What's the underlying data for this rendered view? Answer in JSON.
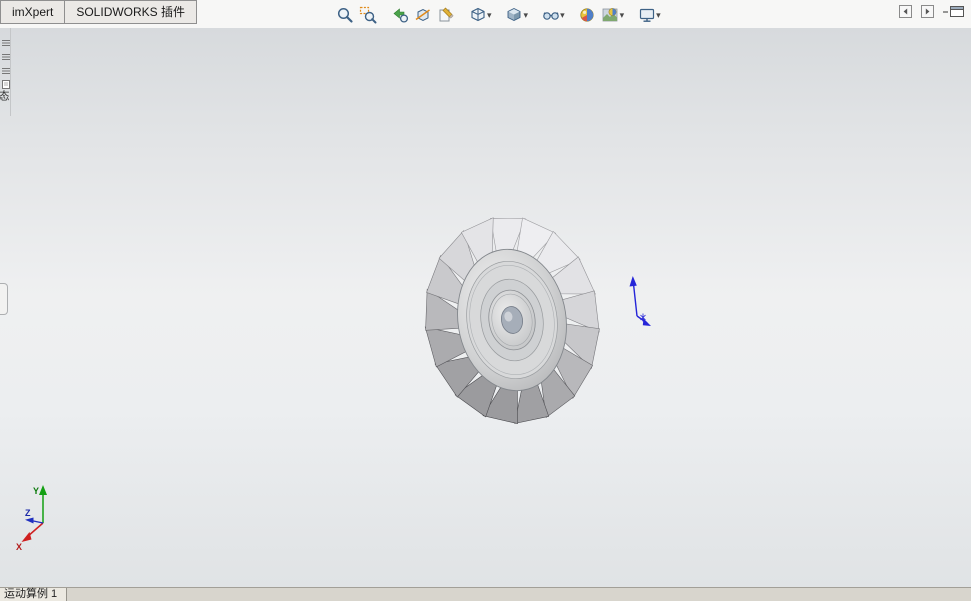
{
  "header": {
    "tabs": [
      {
        "label": "imXpert"
      },
      {
        "label": "SOLIDWORKS 插件"
      }
    ],
    "toolbar_icons": [
      {
        "name": "zoom-to-fit",
        "dropdown": false
      },
      {
        "name": "zoom-to-area",
        "dropdown": false
      },
      {
        "name": "previous-view",
        "dropdown": false
      },
      {
        "name": "section-view",
        "dropdown": false
      },
      {
        "name": "dynamic-annotation-views",
        "dropdown": false
      },
      {
        "name": "view-orientation",
        "dropdown": true
      },
      {
        "name": "display-style",
        "dropdown": true
      },
      {
        "name": "hide-show-items",
        "dropdown": true
      },
      {
        "name": "edit-appearance",
        "dropdown": false
      },
      {
        "name": "apply-scene",
        "dropdown": true
      },
      {
        "name": "view-settings",
        "dropdown": true
      }
    ],
    "right_controls": [
      "collapse-pane-back",
      "collapse-pane-forward",
      "undock-window"
    ]
  },
  "left_panel": {
    "vertical_label": "态"
  },
  "viewport": {
    "model": {
      "name": "turbine-impeller-wheel",
      "blade_count": 17
    },
    "triad": {
      "y_label": "Y",
      "x_label": "X",
      "z_label": "Z"
    }
  },
  "status_bar": {
    "motion_study_tab": "运动算例 1"
  }
}
